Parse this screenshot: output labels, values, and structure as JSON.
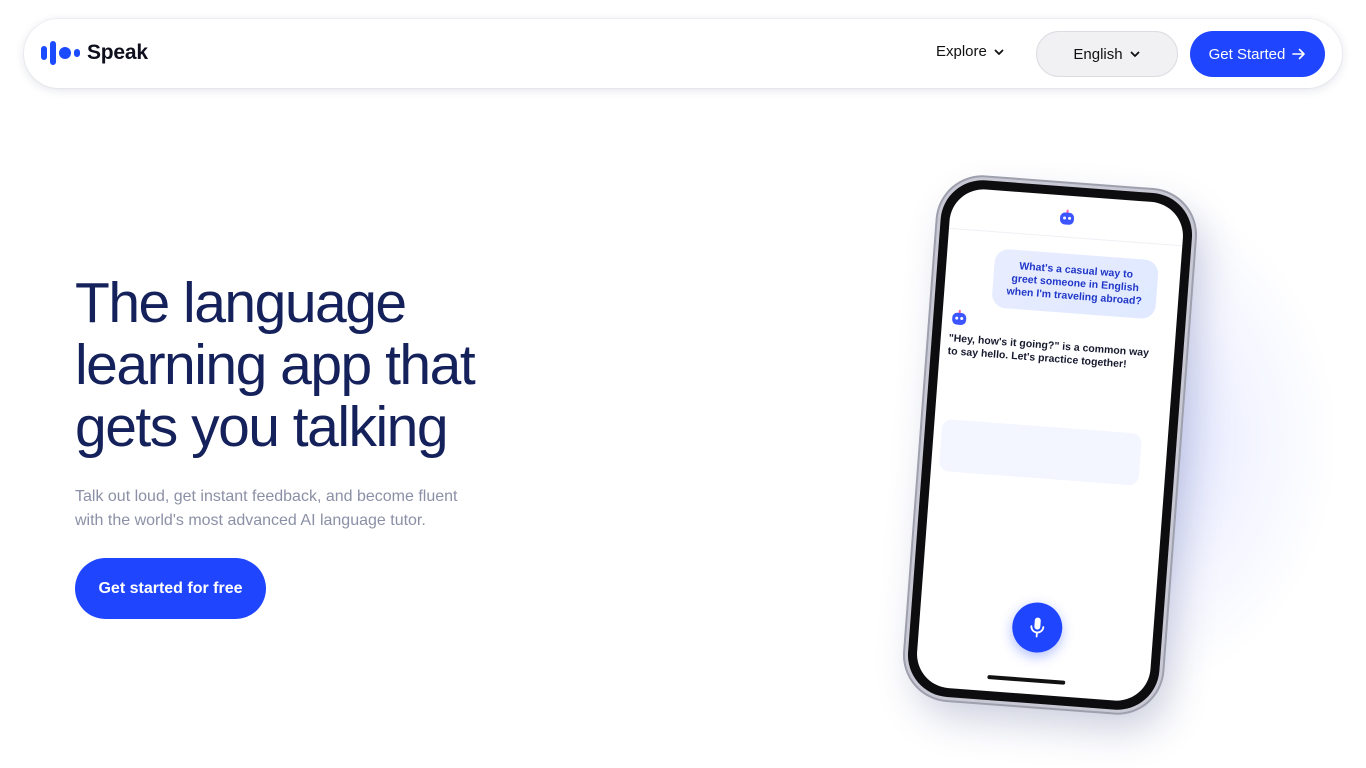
{
  "nav": {
    "brand": "Speak",
    "explore_label": "Explore",
    "language_label": "English",
    "cta_label": "Get Started"
  },
  "hero": {
    "title_lines": [
      "The language",
      "learning app that",
      "gets you talking"
    ],
    "subtitle_lines": [
      "Talk out loud, get instant feedback, and become fluent",
      "with the world's most advanced AI language tutor."
    ],
    "cta_label": "Get started for free"
  },
  "phone": {
    "user_message": "What's a casual way to greet someone in English when I'm traveling abroad?",
    "bot_message": "\"Hey, how's it going?\" is a common way to say hello. Let's practice together!"
  },
  "colors": {
    "accent": "#1f45ff",
    "heading": "#14215b",
    "muted": "#8b90a6"
  },
  "icons": {
    "logo": "speak-logo-icon",
    "explore": "chevron-down-icon",
    "language": "chevron-down-icon",
    "cta": "arrow-right-icon",
    "avatar": "robot-icon",
    "mic": "microphone-icon"
  }
}
